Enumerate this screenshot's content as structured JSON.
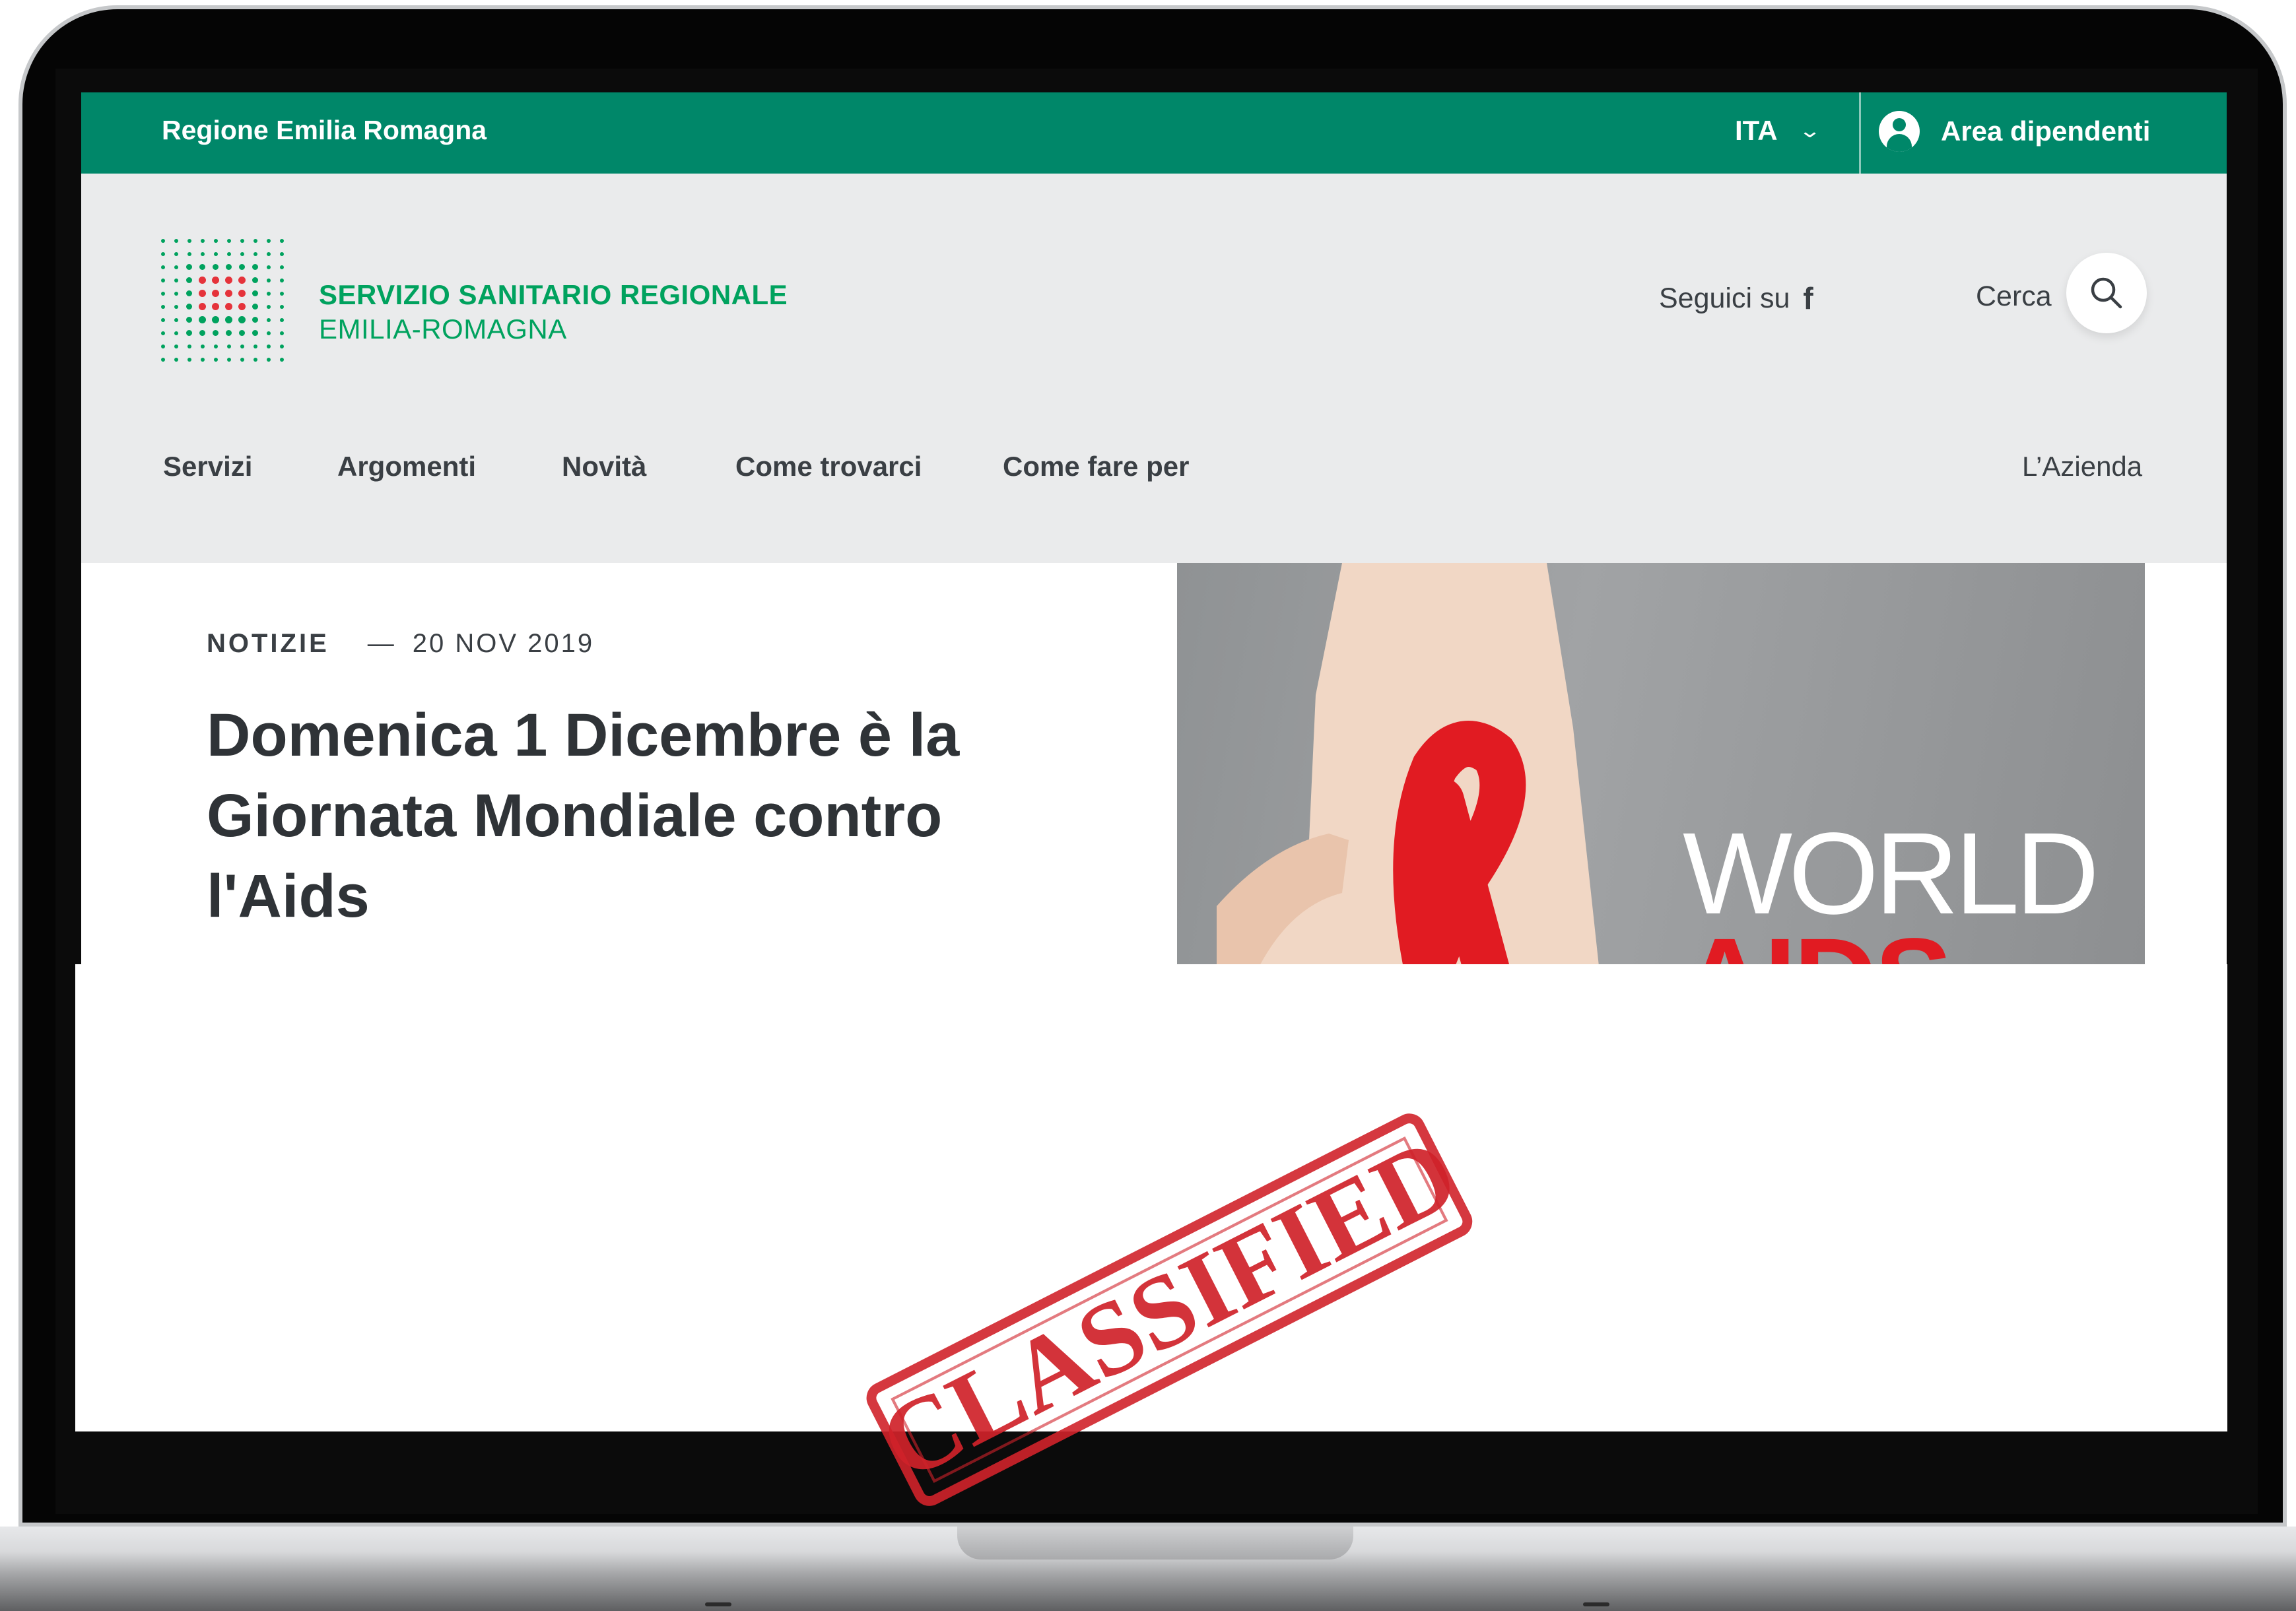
{
  "topbar": {
    "region_label": "Regione Emilia Romagna",
    "language": "ITA",
    "area_label": "Area dipendenti"
  },
  "header": {
    "logo_title": "SERVIZIO SANITARIO REGIONALE",
    "logo_subtitle": "EMILIA-ROMAGNA",
    "social_label": "Seguici su",
    "social_icon": "f",
    "search_label": "Cerca"
  },
  "nav": {
    "items": [
      {
        "label": "Servizi"
      },
      {
        "label": "Argomenti"
      },
      {
        "label": "Novità"
      },
      {
        "label": "Come trovarci"
      },
      {
        "label": "Come fare per"
      }
    ],
    "right_label": "L’Azienda"
  },
  "article": {
    "category": "NOTIZIE",
    "dash": "—",
    "date": "20 NOV 2019",
    "title_lines": [
      "Domenica 1 Dicembre è la",
      "Giornata Mondiale contro",
      "l'Aids"
    ]
  },
  "hero": {
    "line1": "WORLD",
    "line2": "AIDS DAY"
  },
  "stamp": {
    "text": "CLASSIFIED",
    "color": "#d0222a"
  },
  "colors": {
    "brand_green": "#008769",
    "logo_green": "#00a25e",
    "logo_red": "#e5333b",
    "text_dark": "#2f3337"
  }
}
